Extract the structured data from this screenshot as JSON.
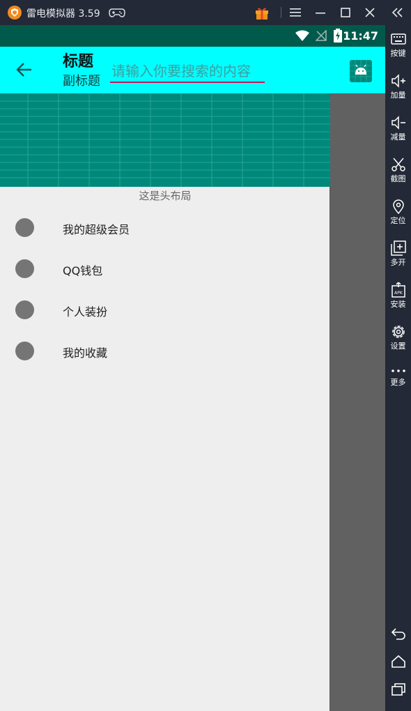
{
  "window": {
    "app_name": "雷电模拟器 3.59"
  },
  "statusbar": {
    "time": "11:47"
  },
  "toolbar": {
    "title": "标题",
    "subtitle": "副标题",
    "search_placeholder": "请输入你要搜索的内容",
    "search_value": ""
  },
  "drawer": {
    "header_text": "这是头布局",
    "items": [
      {
        "label": "我的超级会员"
      },
      {
        "label": "QQ钱包"
      },
      {
        "label": "个人装扮"
      },
      {
        "label": "我的收藏"
      }
    ]
  },
  "sidebar": {
    "items": [
      {
        "label": "按键",
        "icon": "keyboard-icon"
      },
      {
        "label": "加量",
        "icon": "volume-up-icon"
      },
      {
        "label": "减量",
        "icon": "volume-down-icon"
      },
      {
        "label": "截图",
        "icon": "scissors-icon"
      },
      {
        "label": "定位",
        "icon": "location-pin-icon"
      },
      {
        "label": "多开",
        "icon": "multi-instance-icon"
      },
      {
        "label": "安装",
        "icon": "apk-install-icon"
      },
      {
        "label": "设置",
        "icon": "gear-icon"
      },
      {
        "label": "更多",
        "icon": "more-dots-icon"
      }
    ],
    "bottom": [
      {
        "icon": "android-back-icon"
      },
      {
        "icon": "android-home-icon"
      },
      {
        "icon": "android-recents-icon"
      }
    ]
  },
  "colors": {
    "statusbar": "#005a4b",
    "toolbar": "#00ffff",
    "header_image": "#00897b",
    "drawer_bg": "#eeeeee",
    "scrim": "#616161",
    "emulator_chrome": "#232936",
    "search_underline": "#c2185b"
  }
}
